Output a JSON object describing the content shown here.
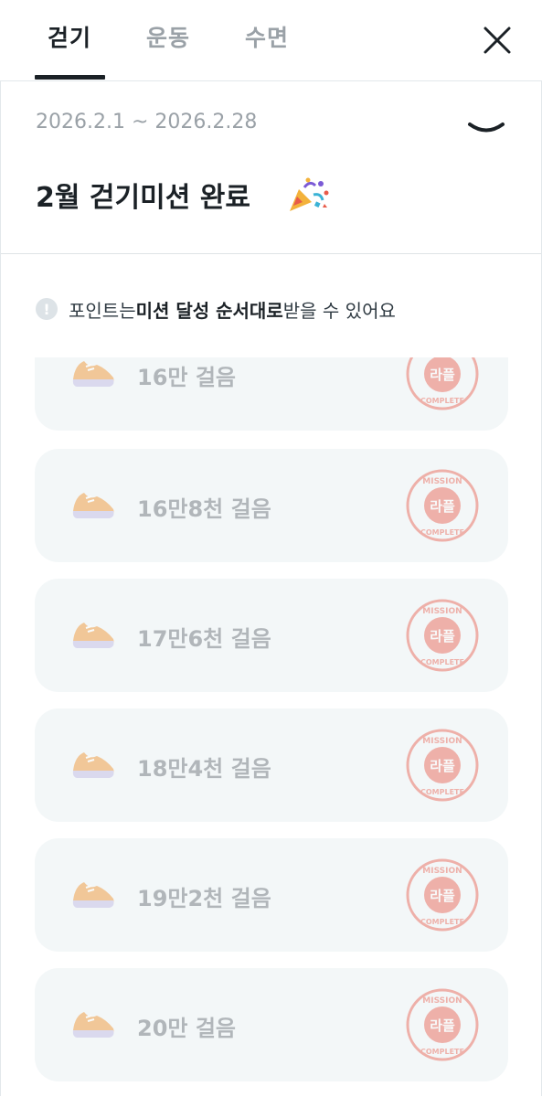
{
  "tabs": [
    {
      "label": "걷기",
      "active": true
    },
    {
      "label": "운동",
      "active": false
    },
    {
      "label": "수면",
      "active": false
    }
  ],
  "header": {
    "period": "2026.2.1 ~ 2026.2.28",
    "title": "2월 걷기미션 완료"
  },
  "notice": {
    "prefix": "포인트는 ",
    "bold": "미션 달성 순서대로",
    "suffix": " 받을 수 있어요"
  },
  "stamp": {
    "top": "MISSION",
    "center": "라플",
    "bottom": "COMPLETE"
  },
  "missions": [
    {
      "label": "16만 걸음",
      "status": "complete"
    },
    {
      "label": "16만8천 걸음",
      "status": "complete"
    },
    {
      "label": "17만6천 걸음",
      "status": "complete"
    },
    {
      "label": "18만4천 걸음",
      "status": "complete"
    },
    {
      "label": "19만2천 걸음",
      "status": "complete"
    },
    {
      "label": "20만 걸음",
      "status": "complete"
    }
  ],
  "colors": {
    "text_dark": "#1b2126",
    "text_muted": "#9aa1a7",
    "card_bg": "#f3f7f8",
    "stamp_red": "#e8503f"
  },
  "icons": {
    "close": "close-icon",
    "expand": "chevron-down-icon",
    "celebrate": "party-popper-icon",
    "info": "info-icon",
    "shoe": "shoe-icon",
    "stamp": "mission-complete-stamp"
  }
}
